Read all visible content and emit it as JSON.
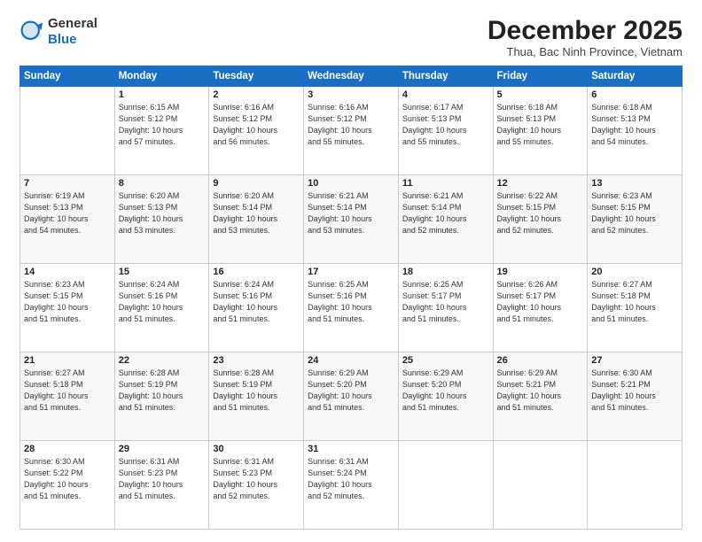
{
  "logo": {
    "general": "General",
    "blue": "Blue"
  },
  "header": {
    "month": "December 2025",
    "location": "Thua, Bac Ninh Province, Vietnam"
  },
  "days_of_week": [
    "Sunday",
    "Monday",
    "Tuesday",
    "Wednesday",
    "Thursday",
    "Friday",
    "Saturday"
  ],
  "weeks": [
    [
      {
        "day": "",
        "info": ""
      },
      {
        "day": "1",
        "info": "Sunrise: 6:15 AM\nSunset: 5:12 PM\nDaylight: 10 hours\nand 57 minutes."
      },
      {
        "day": "2",
        "info": "Sunrise: 6:16 AM\nSunset: 5:12 PM\nDaylight: 10 hours\nand 56 minutes."
      },
      {
        "day": "3",
        "info": "Sunrise: 6:16 AM\nSunset: 5:12 PM\nDaylight: 10 hours\nand 55 minutes."
      },
      {
        "day": "4",
        "info": "Sunrise: 6:17 AM\nSunset: 5:13 PM\nDaylight: 10 hours\nand 55 minutes."
      },
      {
        "day": "5",
        "info": "Sunrise: 6:18 AM\nSunset: 5:13 PM\nDaylight: 10 hours\nand 55 minutes."
      },
      {
        "day": "6",
        "info": "Sunrise: 6:18 AM\nSunset: 5:13 PM\nDaylight: 10 hours\nand 54 minutes."
      }
    ],
    [
      {
        "day": "7",
        "info": "Sunrise: 6:19 AM\nSunset: 5:13 PM\nDaylight: 10 hours\nand 54 minutes."
      },
      {
        "day": "8",
        "info": "Sunrise: 6:20 AM\nSunset: 5:13 PM\nDaylight: 10 hours\nand 53 minutes."
      },
      {
        "day": "9",
        "info": "Sunrise: 6:20 AM\nSunset: 5:14 PM\nDaylight: 10 hours\nand 53 minutes."
      },
      {
        "day": "10",
        "info": "Sunrise: 6:21 AM\nSunset: 5:14 PM\nDaylight: 10 hours\nand 53 minutes."
      },
      {
        "day": "11",
        "info": "Sunrise: 6:21 AM\nSunset: 5:14 PM\nDaylight: 10 hours\nand 52 minutes."
      },
      {
        "day": "12",
        "info": "Sunrise: 6:22 AM\nSunset: 5:15 PM\nDaylight: 10 hours\nand 52 minutes."
      },
      {
        "day": "13",
        "info": "Sunrise: 6:23 AM\nSunset: 5:15 PM\nDaylight: 10 hours\nand 52 minutes."
      }
    ],
    [
      {
        "day": "14",
        "info": "Sunrise: 6:23 AM\nSunset: 5:15 PM\nDaylight: 10 hours\nand 51 minutes."
      },
      {
        "day": "15",
        "info": "Sunrise: 6:24 AM\nSunset: 5:16 PM\nDaylight: 10 hours\nand 51 minutes."
      },
      {
        "day": "16",
        "info": "Sunrise: 6:24 AM\nSunset: 5:16 PM\nDaylight: 10 hours\nand 51 minutes."
      },
      {
        "day": "17",
        "info": "Sunrise: 6:25 AM\nSunset: 5:16 PM\nDaylight: 10 hours\nand 51 minutes."
      },
      {
        "day": "18",
        "info": "Sunrise: 6:25 AM\nSunset: 5:17 PM\nDaylight: 10 hours\nand 51 minutes."
      },
      {
        "day": "19",
        "info": "Sunrise: 6:26 AM\nSunset: 5:17 PM\nDaylight: 10 hours\nand 51 minutes."
      },
      {
        "day": "20",
        "info": "Sunrise: 6:27 AM\nSunset: 5:18 PM\nDaylight: 10 hours\nand 51 minutes."
      }
    ],
    [
      {
        "day": "21",
        "info": "Sunrise: 6:27 AM\nSunset: 5:18 PM\nDaylight: 10 hours\nand 51 minutes."
      },
      {
        "day": "22",
        "info": "Sunrise: 6:28 AM\nSunset: 5:19 PM\nDaylight: 10 hours\nand 51 minutes."
      },
      {
        "day": "23",
        "info": "Sunrise: 6:28 AM\nSunset: 5:19 PM\nDaylight: 10 hours\nand 51 minutes."
      },
      {
        "day": "24",
        "info": "Sunrise: 6:29 AM\nSunset: 5:20 PM\nDaylight: 10 hours\nand 51 minutes."
      },
      {
        "day": "25",
        "info": "Sunrise: 6:29 AM\nSunset: 5:20 PM\nDaylight: 10 hours\nand 51 minutes."
      },
      {
        "day": "26",
        "info": "Sunrise: 6:29 AM\nSunset: 5:21 PM\nDaylight: 10 hours\nand 51 minutes."
      },
      {
        "day": "27",
        "info": "Sunrise: 6:30 AM\nSunset: 5:21 PM\nDaylight: 10 hours\nand 51 minutes."
      }
    ],
    [
      {
        "day": "28",
        "info": "Sunrise: 6:30 AM\nSunset: 5:22 PM\nDaylight: 10 hours\nand 51 minutes."
      },
      {
        "day": "29",
        "info": "Sunrise: 6:31 AM\nSunset: 5:23 PM\nDaylight: 10 hours\nand 51 minutes."
      },
      {
        "day": "30",
        "info": "Sunrise: 6:31 AM\nSunset: 5:23 PM\nDaylight: 10 hours\nand 52 minutes."
      },
      {
        "day": "31",
        "info": "Sunrise: 6:31 AM\nSunset: 5:24 PM\nDaylight: 10 hours\nand 52 minutes."
      },
      {
        "day": "",
        "info": ""
      },
      {
        "day": "",
        "info": ""
      },
      {
        "day": "",
        "info": ""
      }
    ]
  ]
}
